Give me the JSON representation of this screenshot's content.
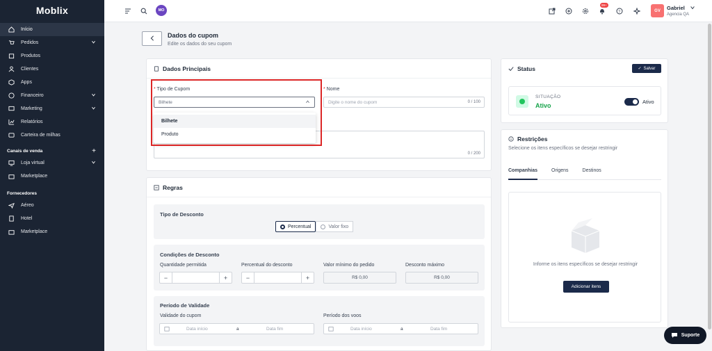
{
  "brand": {
    "logo": "Moblix"
  },
  "sidebar": {
    "items": [
      {
        "label": "Início",
        "icon": "home-icon",
        "active": true
      },
      {
        "label": "Pedidos",
        "icon": "cart-icon",
        "chevron": true
      },
      {
        "label": "Produtos",
        "icon": "box-icon"
      },
      {
        "label": "Clientes",
        "icon": "user-icon"
      },
      {
        "label": "Apps",
        "icon": "apps-icon"
      },
      {
        "label": "Financeiro",
        "icon": "dollar-icon",
        "chevron": true
      },
      {
        "label": "Marketing",
        "icon": "marketing-icon",
        "chevron": true
      },
      {
        "label": "Relatórios",
        "icon": "report-icon"
      },
      {
        "label": "Carteira de milhas",
        "icon": "wallet-icon"
      }
    ],
    "sales_title": "Canais de venda",
    "sales_items": [
      {
        "label": "Loja virtual",
        "icon": "monitor-icon",
        "chevron": true
      },
      {
        "label": "Marketplace",
        "icon": "store-icon"
      }
    ],
    "suppliers_title": "Fornecedores",
    "supplier_items": [
      {
        "label": "Aéreo",
        "icon": "plane-icon"
      },
      {
        "label": "Hotel",
        "icon": "hotel-icon"
      },
      {
        "label": "Marketplace",
        "icon": "store-icon"
      }
    ]
  },
  "topbar": {
    "avatar_initials": "MO",
    "notif_badge": "99+",
    "user_initials": "GV",
    "user_name": "Gabriel",
    "user_agency": "Agencia QA"
  },
  "page": {
    "title": "Dados do cupom",
    "subtitle": "Edite os dados do seu cupom"
  },
  "dados": {
    "title": "Dados Principais",
    "tipo_label": "Tipo de Cupom",
    "tipo_value": "Bilhete",
    "nome_label": "Nome",
    "nome_placeholder": "Digite o nome do cupom",
    "nome_counter": "0 / 100",
    "desc_counter": "0 / 200",
    "options": [
      "Bilhete",
      "Produto"
    ]
  },
  "regras": {
    "title": "Regras",
    "tipo_desconto": "Tipo de Desconto",
    "radio_percentual": "Percentual",
    "radio_valor": "Valor fixo",
    "condicoes": "Condições de Desconto",
    "qtd_label": "Quantidade permitida",
    "perc_label": "Percentual do desconto",
    "min_label": "Valor mínimo do pedido",
    "max_label": "Desconto máximo",
    "min_value": "R$ 0,00",
    "max_value": "R$ 0,00",
    "periodo": "Período de Validade",
    "validade_label": "Validade do cupom",
    "voos_label": "Período dos voos",
    "date_start": "Data início",
    "date_sep": "a",
    "date_end": "Data fim"
  },
  "status": {
    "title": "Status",
    "save_label": "Salvar",
    "situacao_label": "SITUAÇÃO",
    "situacao_value": "Ativo",
    "toggle_label": "Ativo",
    "toggle_on": true
  },
  "restricoes": {
    "title": "Restrições",
    "subtitle": "Selecione os itens específicos se desejar restringir",
    "tabs": [
      "Companhias",
      "Origens",
      "Destinos"
    ],
    "empty_text": "Informe os itens específicos se desejar restringir",
    "add_label": "Adicionar itens"
  },
  "support": {
    "label": "Suporte"
  },
  "colors": {
    "sidebar": "#1b2433",
    "primary": "#1b2a4a",
    "danger": "#dc2626",
    "success": "#22c55e"
  }
}
